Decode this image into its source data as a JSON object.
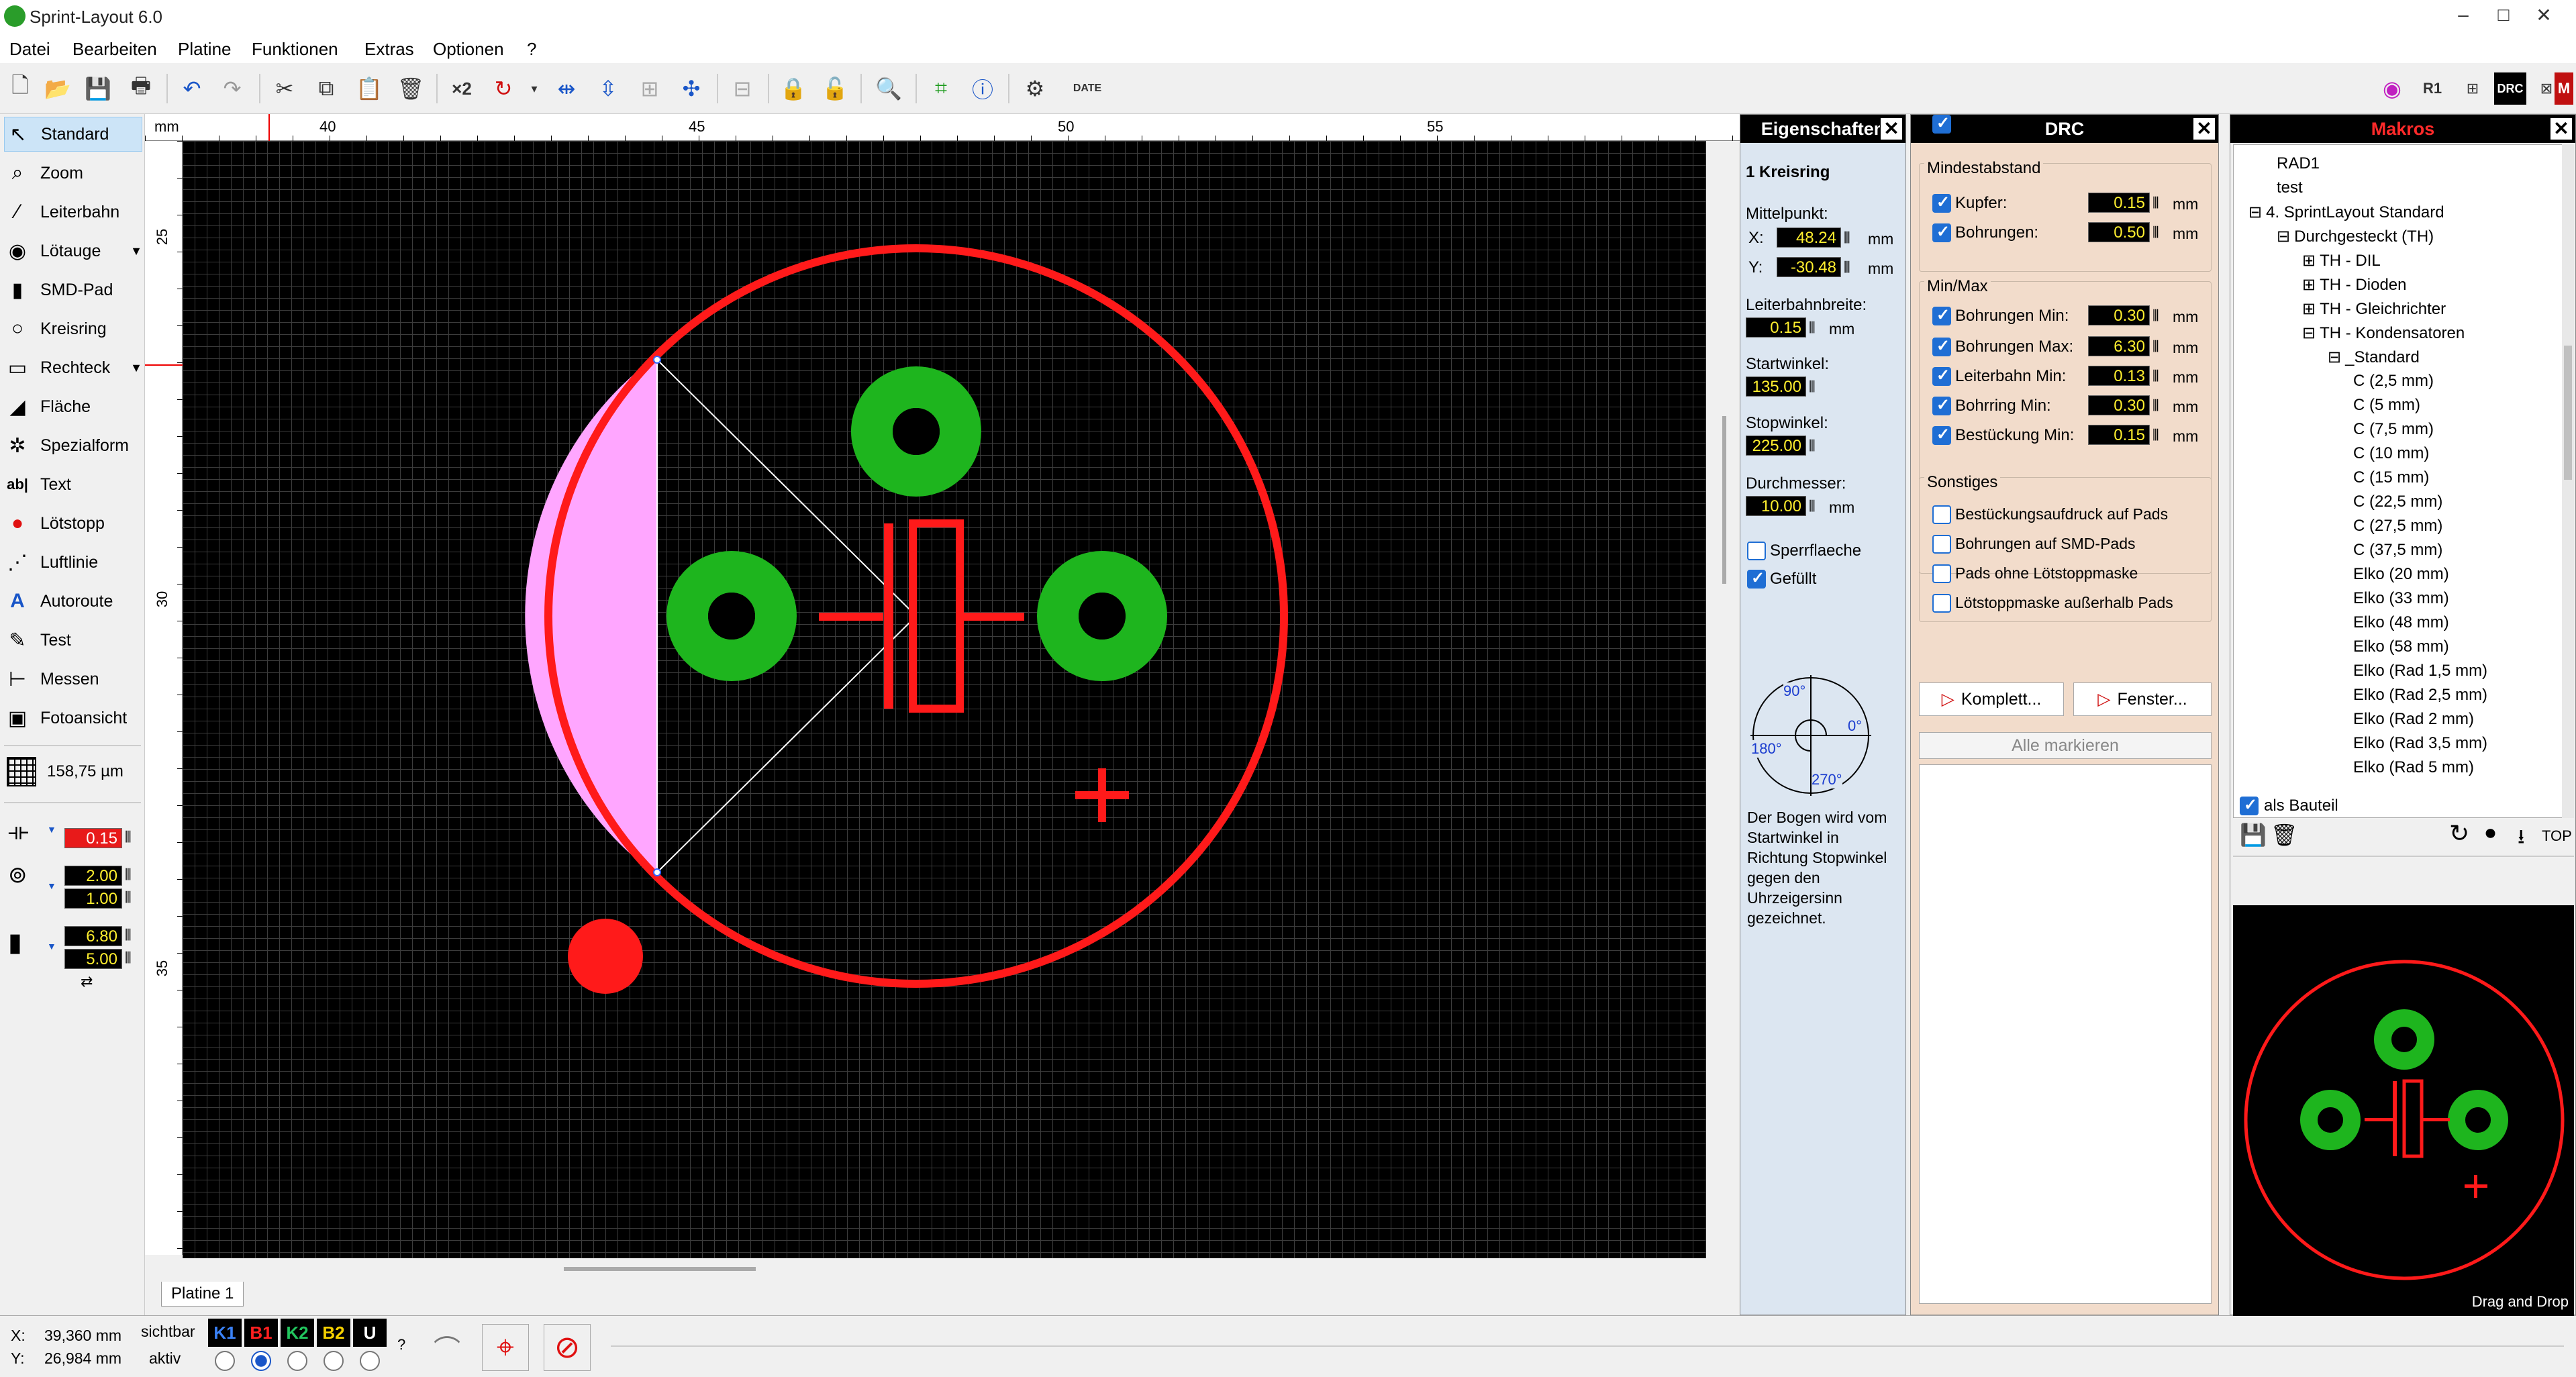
{
  "app": {
    "title": "Sprint-Layout 6.0"
  },
  "window_controls": {
    "minimize": "–",
    "maximize": "□",
    "close": "✕"
  },
  "menu": [
    "Datei",
    "Bearbeiten",
    "Platine",
    "Funktionen",
    "Extras",
    "Optionen",
    "?"
  ],
  "toolbar_right": [
    "R1",
    "DRC",
    "M"
  ],
  "tools": [
    {
      "label": "Standard",
      "icon": "↖"
    },
    {
      "label": "Zoom",
      "icon": "⌕"
    },
    {
      "label": "Leiterbahn",
      "icon": "∕"
    },
    {
      "label": "Lötauge",
      "icon": "◉"
    },
    {
      "label": "SMD-Pad",
      "icon": "▮"
    },
    {
      "label": "Kreisring",
      "icon": "○"
    },
    {
      "label": "Rechteck",
      "icon": "▭"
    },
    {
      "label": "Fläche",
      "icon": "◢"
    },
    {
      "label": "Spezialform",
      "icon": "✲"
    },
    {
      "label": "Text",
      "icon": "ab|"
    },
    {
      "label": "Lötstopp",
      "icon": "●"
    },
    {
      "label": "Luftlinie",
      "icon": "⋰"
    },
    {
      "label": "Autoroute",
      "icon": "A"
    },
    {
      "label": "Test",
      "icon": "✎"
    },
    {
      "label": "Messen",
      "icon": "⊢"
    },
    {
      "label": "Fotoansicht",
      "icon": "▣"
    }
  ],
  "grid": {
    "label": "158,75 µm"
  },
  "tool_values": {
    "track": "0.15",
    "pad_outer": "2.00",
    "pad_inner": "1.00",
    "smd_w": "6.80",
    "smd_h": "5.00"
  },
  "ruler": {
    "unit": "mm",
    "top": [
      "40",
      "45",
      "50",
      "55"
    ],
    "left": [
      "25",
      "30",
      "35"
    ]
  },
  "sheet_tab": "Platine 1",
  "status": {
    "x_label": "X:",
    "x_value": "39,360 mm",
    "y_label": "Y:",
    "y_value": "26,984 mm",
    "sichtbar": "sichtbar",
    "aktiv": "aktiv",
    "help": "?"
  },
  "layers": [
    {
      "name": "K1",
      "color": "#3b82f6"
    },
    {
      "name": "B1",
      "color": "#ff2020"
    },
    {
      "name": "K2",
      "color": "#22c55e"
    },
    {
      "name": "B2",
      "color": "#f5d000"
    },
    {
      "name": "U",
      "color": "#ffffff"
    }
  ],
  "properties": {
    "title": "Eigenschaften",
    "object": "1 Kreisring",
    "mittelpunkt": "Mittelpunkt:",
    "x_label": "X:",
    "x": "48.24",
    "y_label": "Y:",
    "y": "-30.48",
    "leiterbahnbreite_label": "Leiterbahnbreite:",
    "leiterbahnbreite": "0.15",
    "startwinkel_label": "Startwinkel:",
    "startwinkel": "135.00",
    "stopwinkel_label": "Stopwinkel:",
    "stopwinkel": "225.00",
    "durchmesser_label": "Durchmesser:",
    "durchmesser": "10.00",
    "unit": "mm",
    "sperrflaeche": "Sperrflaeche",
    "gefuellt": "Gefüllt",
    "angles": {
      "a90": "90°",
      "a0": "0°",
      "a180": "180°",
      "a270": "270°"
    },
    "help": "Der Bogen wird vom Startwinkel in Richtung Stopwinkel gegen den Uhrzeigersinn gezeichnet."
  },
  "drc": {
    "title": "DRC",
    "mindestabstand": "Mindestabstand",
    "kupfer_label": "Kupfer:",
    "kupfer": "0.15",
    "bohrungen_label": "Bohrungen:",
    "bohrungen": "0.50",
    "minmax": "Min/Max",
    "bohr_min_label": "Bohrungen Min:",
    "bohr_min": "0.30",
    "bohr_max_label": "Bohrungen Max:",
    "bohr_max": "6.30",
    "lb_min_label": "Leiterbahn Min:",
    "lb_min": "0.13",
    "bring_min_label": "Bohrring Min:",
    "bring_min": "0.30",
    "best_min_label": "Bestückung Min:",
    "best_min": "0.15",
    "sonstiges": "Sonstiges",
    "opt1": "Bestückungsaufdruck auf Pads",
    "opt2": "Bohrungen auf SMD-Pads",
    "opt3": "Pads ohne Lötstoppmaske",
    "opt4": "Lötstoppmaske außerhalb Pads",
    "komplett": "Komplett...",
    "fenster": "Fenster...",
    "alle": "Alle markieren",
    "unit": "mm"
  },
  "makros": {
    "title": "Makros",
    "tree": [
      {
        "label": "RAD1",
        "indent": 0
      },
      {
        "label": "test",
        "indent": 0
      },
      {
        "label": "4. SprintLayout Standard",
        "indent": -1,
        "exp": "⊟"
      },
      {
        "label": "Durchgesteckt (TH)",
        "indent": 0,
        "exp": "⊟"
      },
      {
        "label": "TH - DIL",
        "indent": 1,
        "exp": "⊞"
      },
      {
        "label": "TH - Dioden",
        "indent": 1,
        "exp": "⊞"
      },
      {
        "label": "TH - Gleichrichter",
        "indent": 1,
        "exp": "⊞"
      },
      {
        "label": "TH - Kondensatoren",
        "indent": 1,
        "exp": "⊟"
      },
      {
        "label": "_Standard",
        "indent": 2,
        "exp": "⊟"
      },
      {
        "label": "C (2,5 mm)",
        "indent": 3
      },
      {
        "label": "C (5 mm)",
        "indent": 3
      },
      {
        "label": "C (7,5 mm)",
        "indent": 3
      },
      {
        "label": "C (10 mm)",
        "indent": 3
      },
      {
        "label": "C (15 mm)",
        "indent": 3
      },
      {
        "label": "C (22,5 mm)",
        "indent": 3
      },
      {
        "label": "C (27,5 mm)",
        "indent": 3
      },
      {
        "label": "C (37,5 mm)",
        "indent": 3
      },
      {
        "label": "Elko (20 mm)",
        "indent": 3
      },
      {
        "label": "Elko (33 mm)",
        "indent": 3
      },
      {
        "label": "Elko (48 mm)",
        "indent": 3
      },
      {
        "label": "Elko (58 mm)",
        "indent": 3
      },
      {
        "label": "Elko (Rad 1,5 mm)",
        "indent": 3
      },
      {
        "label": "Elko (Rad 2,5 mm)",
        "indent": 3
      },
      {
        "label": "Elko (Rad 2 mm)",
        "indent": 3
      },
      {
        "label": "Elko (Rad 3,5 mm)",
        "indent": 3
      },
      {
        "label": "Elko (Rad 5 mm)",
        "indent": 3
      }
    ],
    "als_bauteil": "als Bauteil",
    "top": "TOP",
    "drag": "Drag and Drop"
  }
}
